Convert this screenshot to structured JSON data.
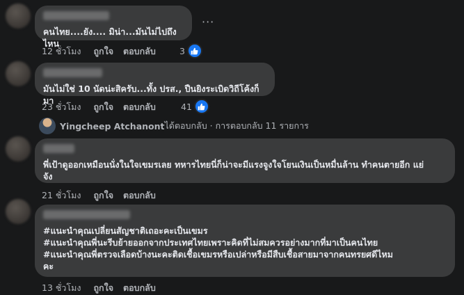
{
  "comments": [
    {
      "text": "คนไทย....ยัง.... มิน่า...มันไม่ไปถึงไหน",
      "time": "12 ชั่วโมง",
      "like": "ถูกใจ",
      "reply": "ตอบกลับ",
      "reactions": "3",
      "more": "···"
    },
    {
      "text": "มันไม่ใช่ 10 นัดน่ะสิครับ...ทั้ง ปรส., ปืนยิงระเบิดวิถีโค้งก็มา",
      "time": "23 ชั่วโมง",
      "like": "ถูกใจ",
      "reply": "ตอบกลับ",
      "reactions": "41"
    },
    {
      "text": "พี่เป้าดูออกเหมือนนั่งในใจเขมรเลย ทหารไทยนี่ก็น่าจะมีแรงจูงใจโยนเงินเป็นหมื่นล้าน ทำคนตายอีก แย่\nจัง",
      "time": "21 ชั่วโมง",
      "like": "ถูกใจ",
      "reply": "ตอบกลับ"
    },
    {
      "text": "#แนะนำคุณเปลี่ยนสัญชาติเถอะคะเป็นเขมร\n#แนะนำคุณพี่นะรีบย้ายออกจากประเทศไทยเพราะคิดที่ไม่สมควรอย่างมากที่มาเป็นคนไทย\n#แนะนำคุณพี่ตรวจเลือดบ้างนะคะติดเชื้อเขมรหรือเปล่าหรือมีสืบเชื้อสายมาจากคนทรยศดีไหม\nคะ",
      "time": "13 ชั่วโมง",
      "like": "ถูกใจ",
      "reply": "ตอบกลับ"
    }
  ],
  "reply_summary": {
    "name": "Yingcheep Atchanont",
    "action": " ได้ตอบกลับ · การตอบกลับ 11 รายการ"
  },
  "colors": {
    "background": "#18191a",
    "bubble": "#3a3b3c",
    "like_blue": "#1877f2"
  }
}
